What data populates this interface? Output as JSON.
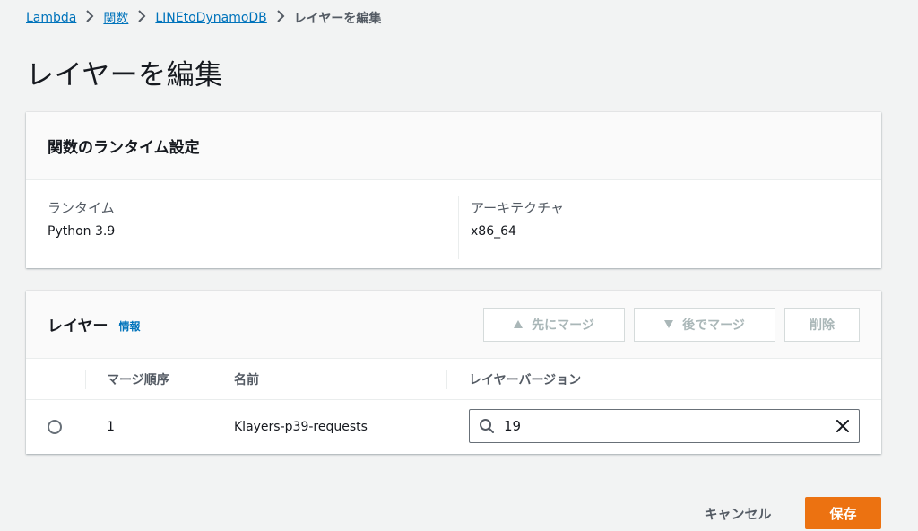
{
  "breadcrumb": {
    "items": [
      "Lambda",
      "関数",
      "LINEtoDynamoDB"
    ],
    "current": "レイヤーを編集",
    "separator": "›"
  },
  "page": {
    "title": "レイヤーを編集"
  },
  "runtime_settings": {
    "title": "関数のランタイム設定",
    "runtime_label": "ランタイム",
    "runtime_value": "Python 3.9",
    "architecture_label": "アーキテクチャ",
    "architecture_value": "x86_64"
  },
  "layers": {
    "title": "レイヤー",
    "info_link": "情報",
    "buttons": {
      "merge_up": "先にマージ",
      "merge_down": "後でマージ",
      "delete": "削除"
    },
    "columns": [
      "マージ順序",
      "名前",
      "レイヤーバージョン"
    ],
    "rows": [
      {
        "order": "1",
        "name": "Klayers-p39-requests",
        "version": "19"
      }
    ]
  },
  "footer": {
    "cancel": "キャンセル",
    "save": "保存"
  },
  "colors": {
    "link": "#0073bb",
    "primary": "#ec7211",
    "disabled": "#aab7b8"
  }
}
